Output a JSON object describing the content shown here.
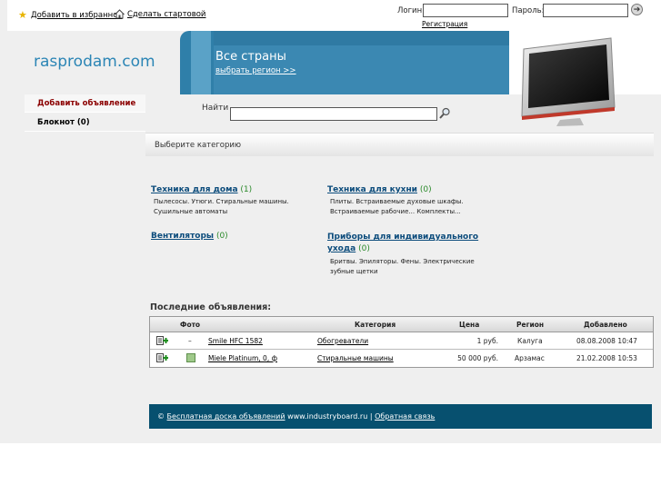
{
  "topbar": {
    "favorites_label": "Добавить в избранное",
    "homepage_label": "Сделать стартовой",
    "login_label": "Логин:",
    "password_label": "Пароль:",
    "register_label": "Регистрация"
  },
  "header": {
    "logo": "rasprodam.com",
    "region_title": "Все страны",
    "region_link": "выбрать регион >>"
  },
  "menu": {
    "add_ad": "Добавить объявление",
    "notepad": "Блокнот (0)"
  },
  "search": {
    "label": "Найти",
    "value": ""
  },
  "category_bar": "Выберите категорию",
  "categories": [
    {
      "title": "Техника для дома",
      "count": "(1)",
      "desc": "Пылесосы. Утюги. Стиральные машины. Сушильные автоматы"
    },
    {
      "title": "Техника для кухни",
      "count": "(0)",
      "desc": "Плиты. Встраиваемые духовые шкафы. Встраиваемые рабочие... Комплекты..."
    },
    {
      "title": "Вентиляторы",
      "count": "(0)",
      "desc": ""
    },
    {
      "title": "Приборы для индивидуального ухода",
      "count": "(0)",
      "desc": "Бритвы. Эпиляторы. Фены. Электрические зубные щетки"
    }
  ],
  "last_ads": {
    "title": "Последние объявления:",
    "columns": [
      "Фото",
      "Категория",
      "Цена",
      "Регион",
      "Добавлено"
    ],
    "rows": [
      {
        "photo": "–",
        "name": "Smile HFC 1582",
        "category": "Обогреватели",
        "price": "1 руб.",
        "region": "Калуга",
        "added": "08.08.2008 10:47"
      },
      {
        "photo": "",
        "name": "Miele Platinum, 0, ф",
        "category": "Стиральные машины",
        "price": "50 000 руб.",
        "region": "Арзамас",
        "added": "21.02.2008 10:53"
      }
    ]
  },
  "footer": {
    "copyright": "©",
    "board_link": "Бесплатная доска объявлений",
    "site": "www.industryboard.ru |",
    "feedback_link": "Обратная связь"
  }
}
